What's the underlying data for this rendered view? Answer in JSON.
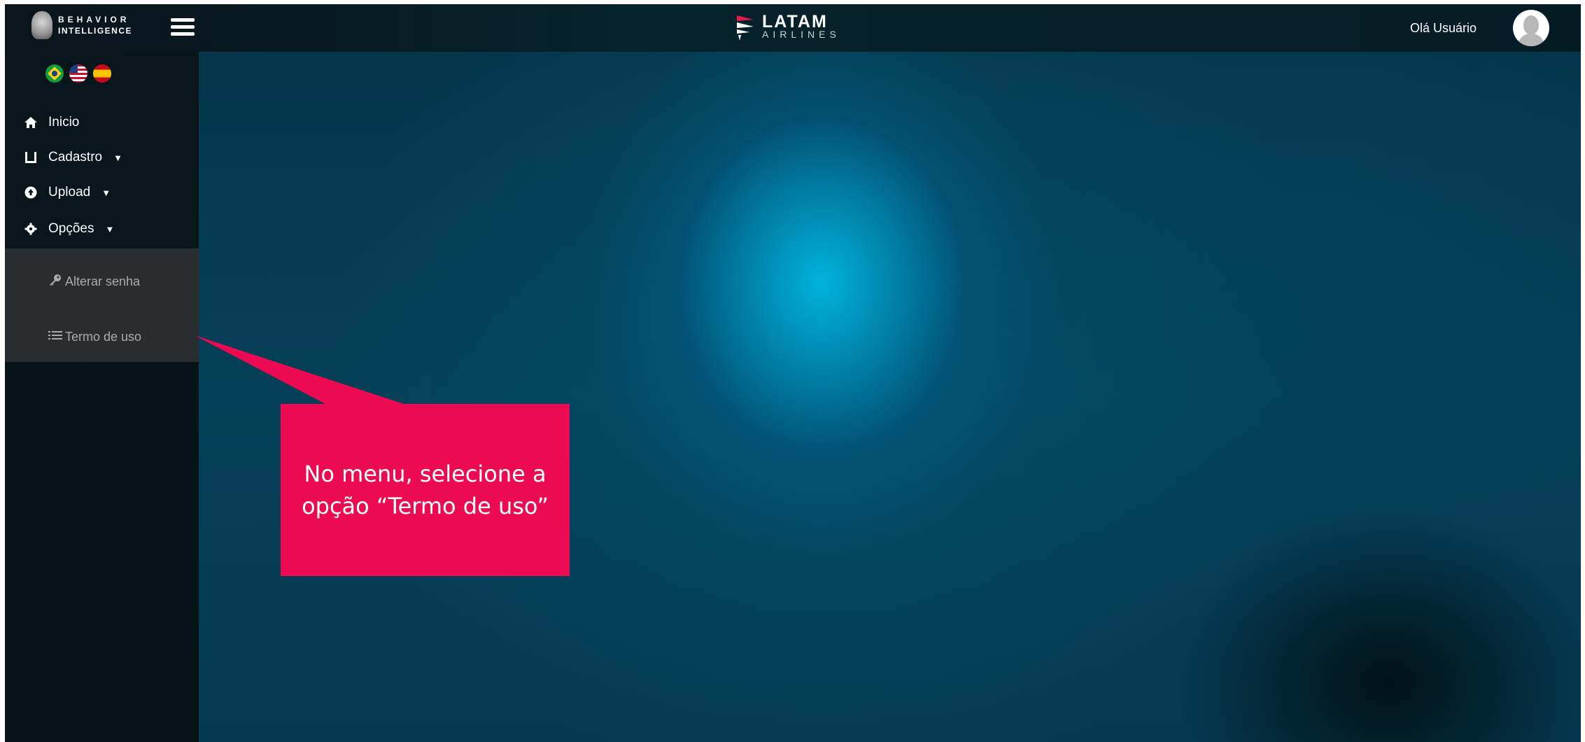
{
  "brand": {
    "line1": "BEHAVIOR",
    "line2": "INTELLIGENCE"
  },
  "center_logo": {
    "name": "LATAM",
    "sub": "AIRLINES"
  },
  "user": {
    "greeting": "Olá Usuário"
  },
  "languages": [
    {
      "icon": "brazil-flag-icon"
    },
    {
      "icon": "usa-flag-icon"
    },
    {
      "icon": "spain-flag-icon"
    }
  ],
  "menu": {
    "inicio": {
      "label": "Inicio",
      "icon": "home-icon"
    },
    "cadastro": {
      "label": "Cadastro",
      "icon": "register-icon"
    },
    "upload": {
      "label": "Upload",
      "icon": "upload-icon"
    },
    "opcoes": {
      "label": "Opções",
      "icon": "gear-icon"
    }
  },
  "submenu": {
    "alterar_senha": {
      "label": "Alterar senha",
      "icon": "key-icon"
    },
    "termo_de_uso": {
      "label": "Termo de uso",
      "icon": "list-icon"
    }
  },
  "callout": {
    "text": "No menu, selecione a opção “Termo de uso”",
    "color": "#ec0a52"
  }
}
